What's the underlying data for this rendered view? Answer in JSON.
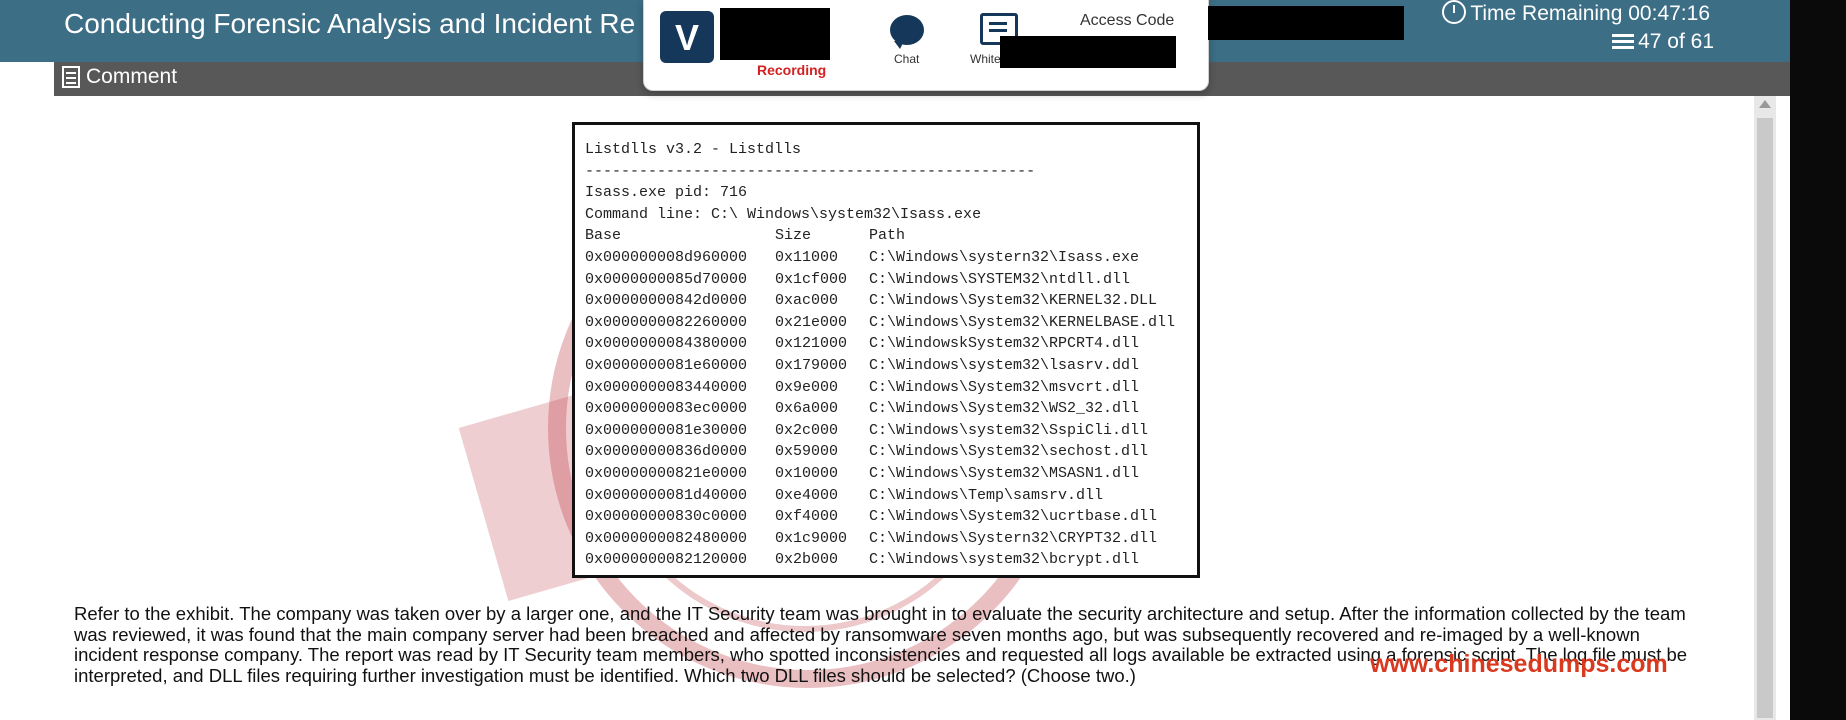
{
  "header": {
    "title": "Conducting Forensic Analysis and Incident Re",
    "time_remaining": "Time Remaining 00:47:16",
    "question_counter": "47 of 61"
  },
  "toolbar": {
    "comment_label": "Comment"
  },
  "overlay": {
    "recording_label": "Recording",
    "chat_label": "Chat",
    "whiteboard_label": "White",
    "access_code_label": "Access Code"
  },
  "exhibit": {
    "title": "Listdlls v3.2 - Listdlls",
    "separator": "--------------------------------------------------",
    "pid_line": "Isass.exe pid: 716",
    "command_line": "Command line: C:\\ Windows\\system32\\Isass.exe",
    "columns": {
      "base": "Base",
      "size": "Size",
      "path": "Path"
    },
    "rows": [
      {
        "base": "0x000000008d960000",
        "size": "0x11000",
        "path": "C:\\Windows\\systern32\\Isass.exe"
      },
      {
        "base": "0x0000000085d70000",
        "size": "0x1cf000",
        "path": "C:\\Windows\\SYSTEM32\\ntdll.dll"
      },
      {
        "base": "0x00000000842d0000",
        "size": "0xac000",
        "path": "C:\\Windows\\System32\\KERNEL32.DLL"
      },
      {
        "base": "0x0000000082260000",
        "size": "0x21e000",
        "path": "C:\\Windows\\System32\\KERNELBASE.dll"
      },
      {
        "base": "0x0000000084380000",
        "size": "0x121000",
        "path": "C:\\WindowskSystem32\\RPCRT4.dll"
      },
      {
        "base": "0x0000000081e60000",
        "size": "0x179000",
        "path": "C:\\Windows\\system32\\lsasrv.ddl"
      },
      {
        "base": "0x0000000083440000",
        "size": "0x9e000",
        "path": "C:\\Windows\\System32\\msvcrt.dll"
      },
      {
        "base": "0x0000000083ec0000",
        "size": "0x6a000",
        "path": "C:\\Windows\\System32\\WS2_32.dll"
      },
      {
        "base": "0x0000000081e30000",
        "size": "0x2c000",
        "path": "C:\\Windows\\system32\\SspiCli.dll"
      },
      {
        "base": "0x00000000836d0000",
        "size": "0x59000",
        "path": "C:\\Windows\\System32\\sechost.dll"
      },
      {
        "base": "0x00000000821e0000",
        "size": "0x10000",
        "path": "C:\\Windows\\System32\\MSASN1.dll"
      },
      {
        "base": "0x0000000081d40000",
        "size": "0xe4000",
        "path": "C:\\Windows\\Temp\\samsrv.dll"
      },
      {
        "base": "0x00000000830c0000",
        "size": "0xf4000",
        "path": "C:\\Windows\\System32\\ucrtbase.dll"
      },
      {
        "base": "0x0000000082480000",
        "size": "0x1c9000",
        "path": "C:\\Windows\\Systern32\\CRYPT32.dll"
      },
      {
        "base": "0x0000000082120000",
        "size": "0x2b000",
        "path": "C:\\Windows\\system32\\bcrypt.dll"
      }
    ]
  },
  "question": {
    "text": "Refer to the exhibit. The company was taken over by a larger one, and the IT Security team was brought in to evaluate the security architecture and setup. After the information collected by the team was reviewed, it was found that the main company server had been breached and affected by ransomware seven months ago, but was subsequently recovered and re-imaged by a well-known incident response company. The report was read by IT Security team members, who spotted inconsistencies and requested all logs available be extracted using a forensic script. The log file must be interpreted, and DLL files requiring further investigation must be identified. Which two DLL files should be selected? (Choose two.)"
  },
  "watermark": {
    "text": "www.chinesedumps.com"
  },
  "colors": {
    "header_bg": "#3c6e86",
    "toolbar_bg": "#585858",
    "logo_bg": "#14375a",
    "recording": "#d32020",
    "watermark": "#d9391e"
  }
}
